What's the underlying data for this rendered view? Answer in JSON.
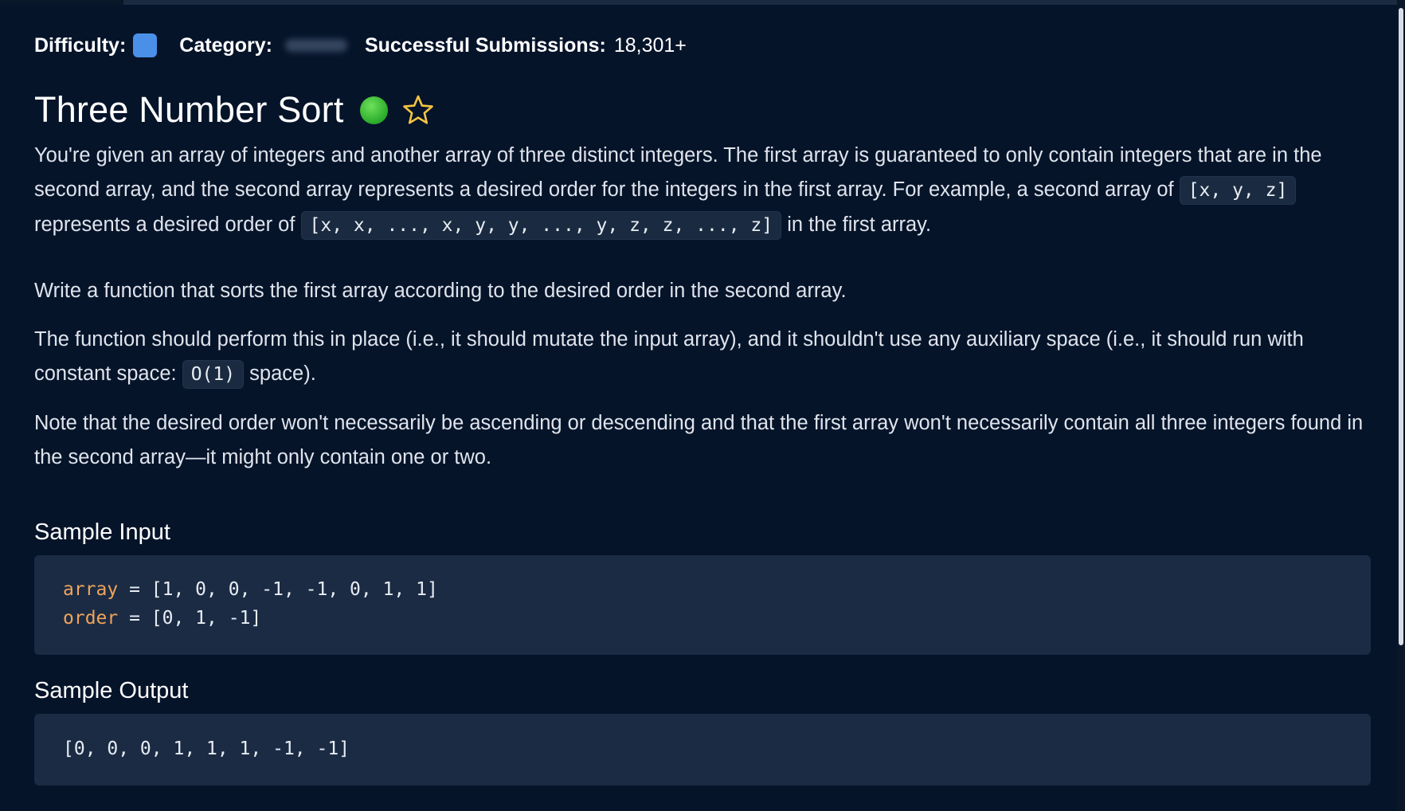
{
  "meta": {
    "difficulty_label": "Difficulty:",
    "category_label": "Category:",
    "submissions_label": "Successful Submissions:",
    "submissions_value": "18,301+",
    "difficulty_color": "#4a90e8"
  },
  "question": {
    "title": "Three Number Sort",
    "status_color": "#2aaa2a"
  },
  "description": {
    "p1": {
      "text1": "You're given an array of integers and another array of three distinct integers. The first array is guaranteed to only contain integers that are in the second array, and the second array represents a desired order for the integers in the first array. For example, a second array of ",
      "code1": "[x, y, z]",
      "text2": " represents a desired order of ",
      "code2": "[x, x, ..., x, y, y, ..., y, z, z, ..., z]",
      "text3": " in the first array."
    },
    "p2": "Write a function that sorts the first array according to the desired order in the second array.",
    "p3": {
      "text1": "The function should perform this in place (i.e., it should mutate the input array), and it shouldn't use any auxiliary space (i.e., it should run with constant space: ",
      "code1": "O(1)",
      "text2": " space)."
    },
    "p4": "Note that the desired order won't necessarily be ascending or descending and that the first array won't necessarily contain all three integers found in the second array—it might only contain one or two."
  },
  "sample_input": {
    "heading": "Sample Input",
    "lines": [
      {
        "var": "array",
        "rest": " = [1, 0, 0, -1, -1, 0, 1, 1]"
      },
      {
        "var": "order",
        "rest": " = [0, 1, -1]"
      }
    ]
  },
  "sample_output": {
    "heading": "Sample Output",
    "value": "[0, 0, 0, 1, 1, 1, -1, -1]"
  },
  "icons": {
    "star": "star-outline-icon",
    "status": "completed-dot-icon"
  }
}
